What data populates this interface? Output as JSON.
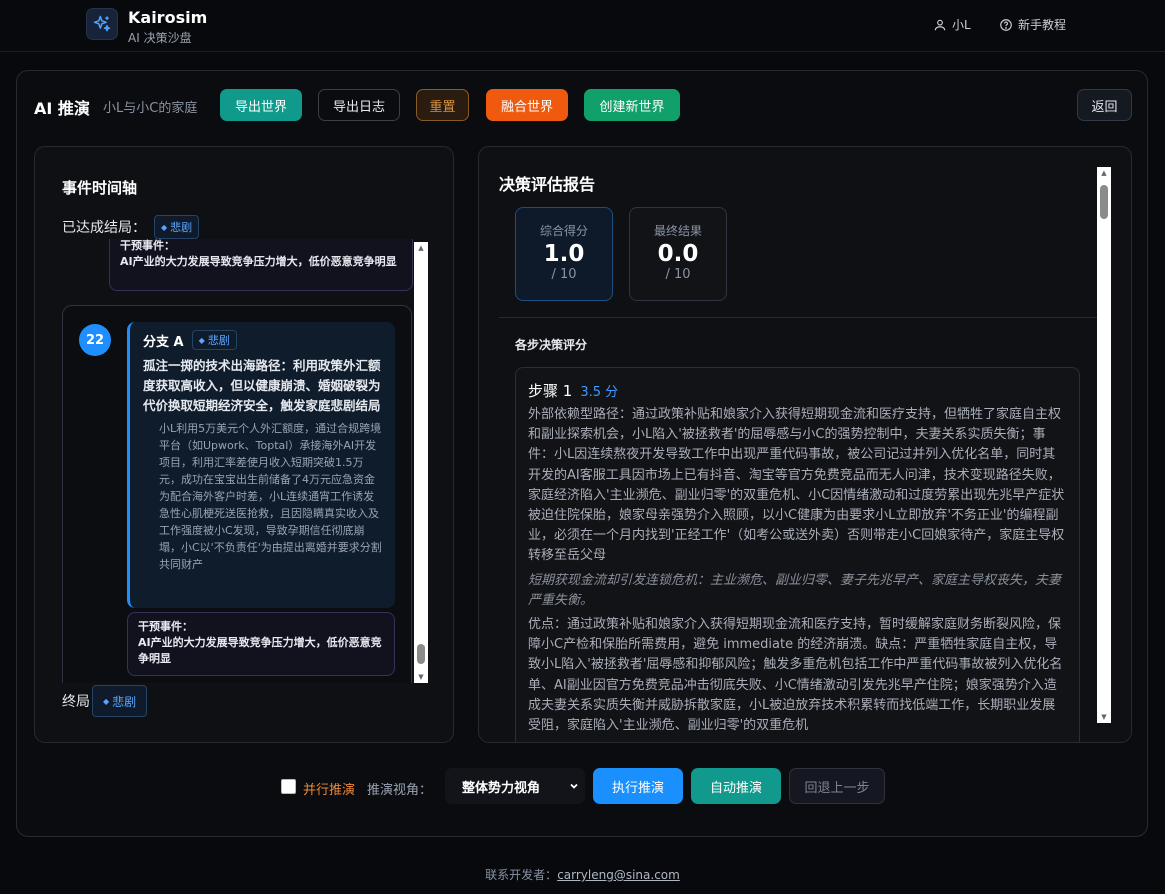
{
  "header": {
    "brand": "Kairosim",
    "subtitle": "AI 决策沙盘",
    "user": "小L",
    "tutorial": "新手教程",
    "icons": {
      "logo": "sparkle-icon",
      "user": "user-icon",
      "help": "help-circle-icon"
    }
  },
  "toolbar": {
    "title": "AI 推演",
    "world_name": "小L与小C的家庭",
    "export_world": "导出世界",
    "export_log": "导出日志",
    "reset": "重置",
    "merge_world": "融合世界",
    "create_world": "创建新世界",
    "back": "返回"
  },
  "timeline": {
    "title": "事件时间轴",
    "reached_label": "已达成结局：",
    "reached_tag": "悲剧",
    "top_intervene_label": "干预事件：",
    "top_intervene_text": "AI产业的大力发展导致竞争压力增大，低价恶意竞争明显",
    "step_number": "22",
    "branch_name": "分支 A",
    "branch_tag": "悲剧",
    "branch_title": "孤注一掷的技术出海路径：利用政策外汇额度获取高收入，但以健康崩溃、婚姻破裂为代价换取短期经济安全，触发家庭悲剧结局",
    "branch_body_1": "小L利用5万美元个人外汇额度，通过合规跨境平台（如Upwork、Toptal）承接海外AI开发项目，利用汇率差使月收入短期突破1.5万元，成功在宝宝出生前储备了4万元应急资金",
    "branch_body_2": "为配合海外客户时差，小L连续通宵工作诱发急性心肌梗死送医抢救，且因隐瞒真实收入及工作强度被小C发现，导致孕期信任彻底崩塌，小C以'不负责任'为由提出离婚并要求分割共同财产",
    "bottom_intervene_label": "干预事件：",
    "bottom_intervene_text": "AI产业的大力发展导致竞争压力增大，低价恶意竞争明显",
    "final_label": "终局",
    "final_tag": "悲剧"
  },
  "report": {
    "title": "决策评估报告",
    "score_label": "综合得分",
    "score_value": "1.0",
    "score_max": "/ 10",
    "result_label": "最终结果",
    "result_value": "0.0",
    "result_max": "/ 10",
    "steps_title": "各步决策评分",
    "step1_title": "步骤 1",
    "step1_score": "3.5 分",
    "step1_text": "外部依赖型路径：通过政策补贴和娘家介入获得短期现金流和医疗支持，但牺牲了家庭自主权和副业探索机会，小L陷入'被拯救者'的屈辱感与小C的强势控制中，夫妻关系实质失衡；事件：小L因连续熬夜开发导致工作中出现严重代码事故，被公司记过并列入优化名单，同时其开发的AI客服工具因市场上已有抖音、淘宝等官方免费竞品而无人问津，技术变现路径失败，家庭经济陷入'主业濒危、副业归零'的双重危机、小C因情绪激动和过度劳累出现先兆早产症状被迫住院保胎，娘家母亲强势介入照顾，以小C健康为由要求小L立即放弃'不务正业'的编程副业，必须在一个月内找到'正经工作'（如考公或送外卖）否则带走小C回娘家待产，家庭主导权转移至岳父母",
    "step1_italic": "短期获现金流却引发连锁危机：主业濒危、副业归零、妻子先兆早产、家庭主导权丧失，夫妻严重失衡。",
    "step1_analysis": "优点：通过政策补贴和娘家介入获得短期现金流和医疗支持，暂时缓解家庭财务断裂风险，保障小C产检和保胎所需费用，避免 immediate 的经济崩溃。缺点：严重牺牲家庭自主权，导致小L陷入'被拯救者'屈辱感和抑郁风险；触发多重危机包括工作中严重代码事故被列入优化名单、AI副业因官方免费竞品冲击彻底失败、小C情绪激动引发先兆早产住院；娘家强势介入造成夫妻关系实质失衡并威胁拆散家庭，小L被迫放弃技术积累转而找低端工作，长期职业发展受阻，家庭陷入'主业濒危、副业归零'的双重危机"
  },
  "controls": {
    "parallel_label": "并行推演",
    "view_label": "推演视角：",
    "view_selected": "整体势力视角",
    "run": "执行推演",
    "auto": "自动推演",
    "undo": "回退上一步"
  },
  "footer": {
    "prefix": "联系开发者：",
    "email": "carryleng@sina.com"
  }
}
